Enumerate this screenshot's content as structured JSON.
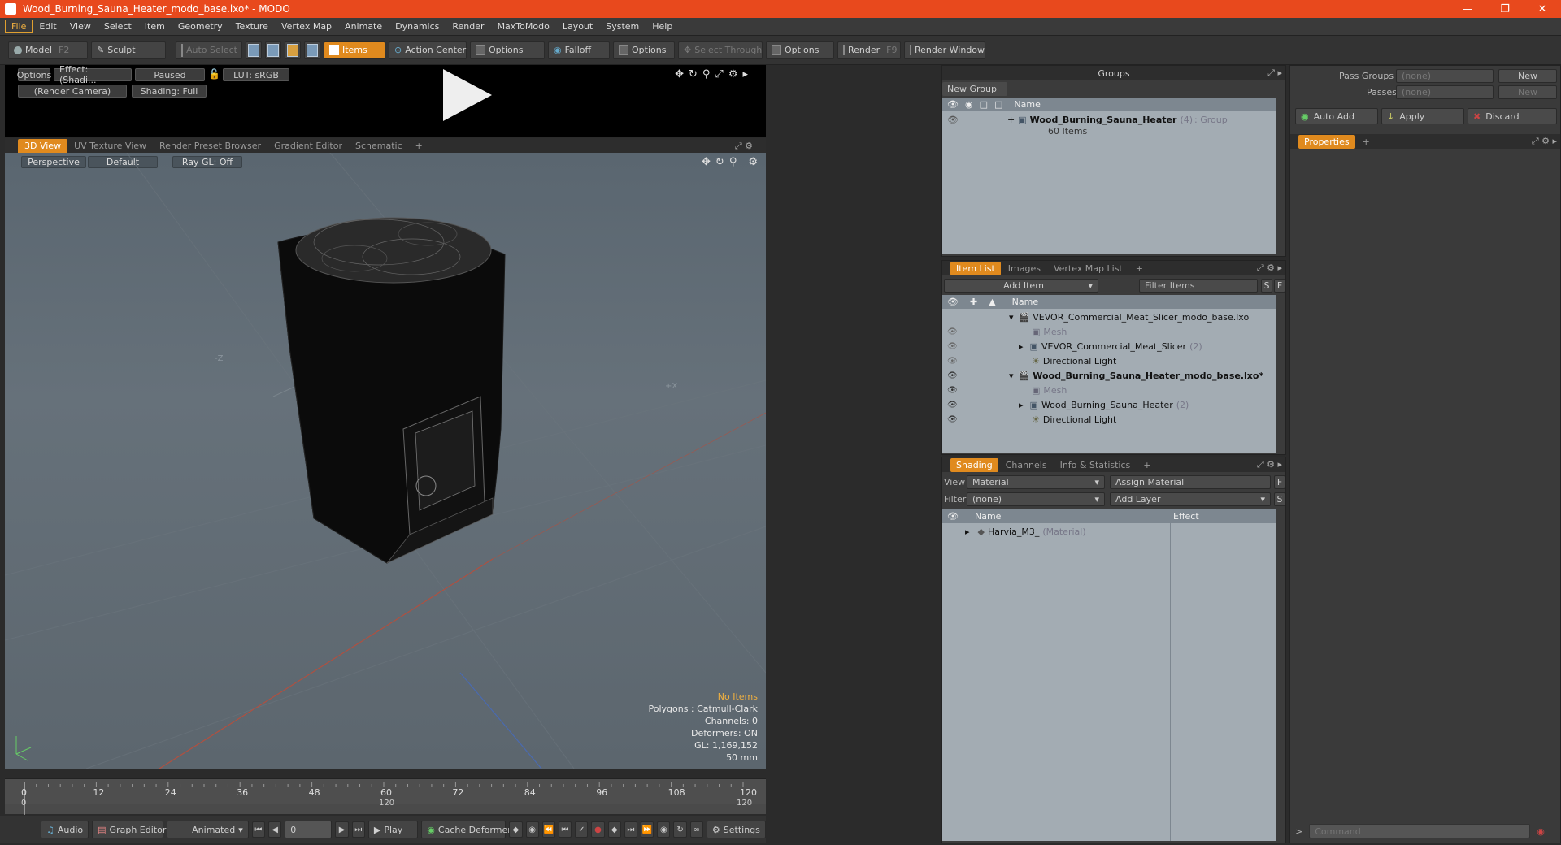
{
  "window": {
    "title": "Wood_Burning_Sauna_Heater_modo_base.lxo* - MODO"
  },
  "menu": [
    "File",
    "Edit",
    "View",
    "Select",
    "Item",
    "Geometry",
    "Texture",
    "Vertex Map",
    "Animate",
    "Dynamics",
    "Render",
    "MaxToModo",
    "Layout",
    "System",
    "Help"
  ],
  "toolbar": {
    "model": "Model",
    "model_key": "F2",
    "sculpt": "Sculpt",
    "auto_select": "Auto Select",
    "items": "Items",
    "action_center": "Action Center",
    "options1": "Options",
    "falloff": "Falloff",
    "options2": "Options",
    "select_through": "Select Through",
    "options3": "Options",
    "render": "Render",
    "render_key": "F9",
    "render_window": "Render Window"
  },
  "preview": {
    "options": "Options",
    "effect": "Effect: (Shadi...",
    "paused": "Paused",
    "lut": "LUT: sRGB",
    "camera": "(Render Camera)",
    "shading": "Shading: Full"
  },
  "viewport_tabs": [
    "3D View",
    "UV Texture View",
    "Render Preset Browser",
    "Gradient Editor",
    "Schematic",
    "+"
  ],
  "viewport": {
    "perspective": "Perspective",
    "default": "Default",
    "raygl": "Ray GL: Off",
    "axis_z": "-Z",
    "axis_x": "+X",
    "info": {
      "no_items": "No Items",
      "polygons": "Polygons : Catmull-Clark",
      "channels": "Channels: 0",
      "deformers": "Deformers: ON",
      "gl": "GL: 1,169,152",
      "focal": "50 mm"
    }
  },
  "timeline": {
    "ticks": [
      "0",
      "12",
      "24",
      "36",
      "48",
      "60",
      "72",
      "84",
      "96",
      "108",
      "120"
    ],
    "sub_start": "0",
    "sub_mid": "120",
    "sub_end": "120"
  },
  "bottombar": {
    "audio": "Audio",
    "graph_editor": "Graph Editor",
    "animated": "Animated",
    "frame": "0",
    "play": "Play",
    "cache": "Cache Deformers",
    "settings": "Settings"
  },
  "groups": {
    "title": "Groups",
    "new_group": "New Group",
    "col_name": "Name",
    "item_name": "Wood_Burning_Sauna_Heater",
    "item_count": "(4)",
    "item_type": ": Group",
    "item_sub": "60 Items"
  },
  "passgroups": {
    "pass_groups": "Pass Groups",
    "pass_value": "(none)",
    "new1": "New",
    "passes": "Passes",
    "passes_value": "(none)",
    "new2": "New",
    "auto_add": "Auto Add",
    "apply": "Apply",
    "discard": "Discard",
    "properties": "Properties",
    "plus": "+"
  },
  "itemlist": {
    "tabs": [
      "Item List",
      "Images",
      "Vertex Map List",
      "+"
    ],
    "add_item": "Add Item",
    "filter": "Filter Items",
    "s": "S",
    "f": "F",
    "col_name": "Name",
    "rows": [
      {
        "label": "VEVOR_Commercial_Meat_Slicer_modo_base.lxo",
        "bold": false
      },
      {
        "label": "Mesh",
        "grey": true
      },
      {
        "label": "VEVOR_Commercial_Meat_Slicer",
        "count": "(2)"
      },
      {
        "label": "Directional Light"
      },
      {
        "label": "Wood_Burning_Sauna_Heater_modo_base.lxo*",
        "bold": true
      },
      {
        "label": "Mesh",
        "grey": true
      },
      {
        "label": "Wood_Burning_Sauna_Heater",
        "count": "(2)"
      },
      {
        "label": "Directional Light"
      }
    ]
  },
  "shading": {
    "tabs": [
      "Shading",
      "Channels",
      "Info & Statistics",
      "+"
    ],
    "view_label": "View",
    "view_value": "Material",
    "assign": "Assign Material",
    "f": "F",
    "filter_label": "Filter",
    "filter_value": "(none)",
    "add_layer": "Add Layer",
    "s": "S",
    "col_name": "Name",
    "col_effect": "Effect",
    "row_name": "Harvia_M3_",
    "row_type": "(Material)"
  },
  "command": {
    "placeholder": "Command"
  },
  "colors": {
    "accent": "#e08a1e",
    "titlebar": "#e8491d"
  }
}
